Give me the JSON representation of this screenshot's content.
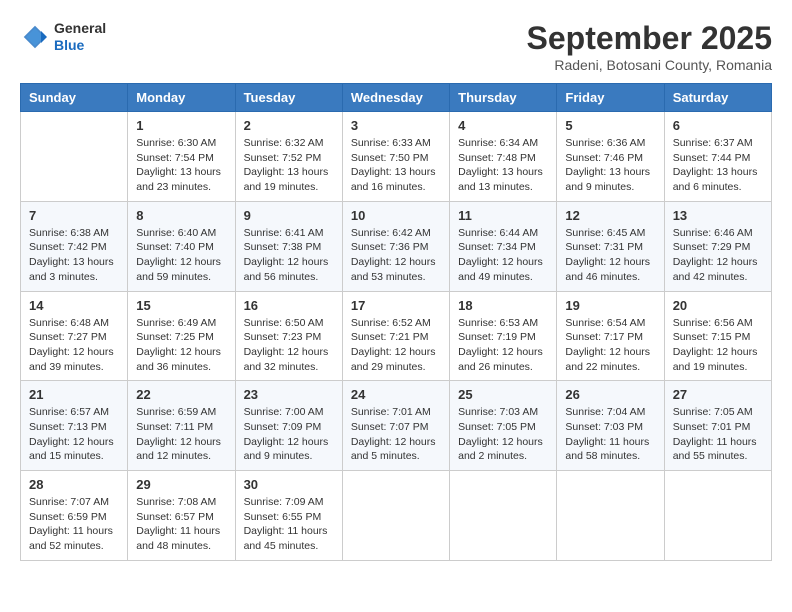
{
  "header": {
    "logo": {
      "text_general": "General",
      "text_blue": "Blue"
    },
    "title": "September 2025",
    "location": "Radeni, Botosani County, Romania"
  },
  "calendar": {
    "days_of_week": [
      "Sunday",
      "Monday",
      "Tuesday",
      "Wednesday",
      "Thursday",
      "Friday",
      "Saturday"
    ],
    "weeks": [
      [
        {
          "day": "",
          "content": ""
        },
        {
          "day": "1",
          "content": "Sunrise: 6:30 AM\nSunset: 7:54 PM\nDaylight: 13 hours\nand 23 minutes."
        },
        {
          "day": "2",
          "content": "Sunrise: 6:32 AM\nSunset: 7:52 PM\nDaylight: 13 hours\nand 19 minutes."
        },
        {
          "day": "3",
          "content": "Sunrise: 6:33 AM\nSunset: 7:50 PM\nDaylight: 13 hours\nand 16 minutes."
        },
        {
          "day": "4",
          "content": "Sunrise: 6:34 AM\nSunset: 7:48 PM\nDaylight: 13 hours\nand 13 minutes."
        },
        {
          "day": "5",
          "content": "Sunrise: 6:36 AM\nSunset: 7:46 PM\nDaylight: 13 hours\nand 9 minutes."
        },
        {
          "day": "6",
          "content": "Sunrise: 6:37 AM\nSunset: 7:44 PM\nDaylight: 13 hours\nand 6 minutes."
        }
      ],
      [
        {
          "day": "7",
          "content": "Sunrise: 6:38 AM\nSunset: 7:42 PM\nDaylight: 13 hours\nand 3 minutes."
        },
        {
          "day": "8",
          "content": "Sunrise: 6:40 AM\nSunset: 7:40 PM\nDaylight: 12 hours\nand 59 minutes."
        },
        {
          "day": "9",
          "content": "Sunrise: 6:41 AM\nSunset: 7:38 PM\nDaylight: 12 hours\nand 56 minutes."
        },
        {
          "day": "10",
          "content": "Sunrise: 6:42 AM\nSunset: 7:36 PM\nDaylight: 12 hours\nand 53 minutes."
        },
        {
          "day": "11",
          "content": "Sunrise: 6:44 AM\nSunset: 7:34 PM\nDaylight: 12 hours\nand 49 minutes."
        },
        {
          "day": "12",
          "content": "Sunrise: 6:45 AM\nSunset: 7:31 PM\nDaylight: 12 hours\nand 46 minutes."
        },
        {
          "day": "13",
          "content": "Sunrise: 6:46 AM\nSunset: 7:29 PM\nDaylight: 12 hours\nand 42 minutes."
        }
      ],
      [
        {
          "day": "14",
          "content": "Sunrise: 6:48 AM\nSunset: 7:27 PM\nDaylight: 12 hours\nand 39 minutes."
        },
        {
          "day": "15",
          "content": "Sunrise: 6:49 AM\nSunset: 7:25 PM\nDaylight: 12 hours\nand 36 minutes."
        },
        {
          "day": "16",
          "content": "Sunrise: 6:50 AM\nSunset: 7:23 PM\nDaylight: 12 hours\nand 32 minutes."
        },
        {
          "day": "17",
          "content": "Sunrise: 6:52 AM\nSunset: 7:21 PM\nDaylight: 12 hours\nand 29 minutes."
        },
        {
          "day": "18",
          "content": "Sunrise: 6:53 AM\nSunset: 7:19 PM\nDaylight: 12 hours\nand 26 minutes."
        },
        {
          "day": "19",
          "content": "Sunrise: 6:54 AM\nSunset: 7:17 PM\nDaylight: 12 hours\nand 22 minutes."
        },
        {
          "day": "20",
          "content": "Sunrise: 6:56 AM\nSunset: 7:15 PM\nDaylight: 12 hours\nand 19 minutes."
        }
      ],
      [
        {
          "day": "21",
          "content": "Sunrise: 6:57 AM\nSunset: 7:13 PM\nDaylight: 12 hours\nand 15 minutes."
        },
        {
          "day": "22",
          "content": "Sunrise: 6:59 AM\nSunset: 7:11 PM\nDaylight: 12 hours\nand 12 minutes."
        },
        {
          "day": "23",
          "content": "Sunrise: 7:00 AM\nSunset: 7:09 PM\nDaylight: 12 hours\nand 9 minutes."
        },
        {
          "day": "24",
          "content": "Sunrise: 7:01 AM\nSunset: 7:07 PM\nDaylight: 12 hours\nand 5 minutes."
        },
        {
          "day": "25",
          "content": "Sunrise: 7:03 AM\nSunset: 7:05 PM\nDaylight: 12 hours\nand 2 minutes."
        },
        {
          "day": "26",
          "content": "Sunrise: 7:04 AM\nSunset: 7:03 PM\nDaylight: 11 hours\nand 58 minutes."
        },
        {
          "day": "27",
          "content": "Sunrise: 7:05 AM\nSunset: 7:01 PM\nDaylight: 11 hours\nand 55 minutes."
        }
      ],
      [
        {
          "day": "28",
          "content": "Sunrise: 7:07 AM\nSunset: 6:59 PM\nDaylight: 11 hours\nand 52 minutes."
        },
        {
          "day": "29",
          "content": "Sunrise: 7:08 AM\nSunset: 6:57 PM\nDaylight: 11 hours\nand 48 minutes."
        },
        {
          "day": "30",
          "content": "Sunrise: 7:09 AM\nSunset: 6:55 PM\nDaylight: 11 hours\nand 45 minutes."
        },
        {
          "day": "",
          "content": ""
        },
        {
          "day": "",
          "content": ""
        },
        {
          "day": "",
          "content": ""
        },
        {
          "day": "",
          "content": ""
        }
      ]
    ]
  }
}
